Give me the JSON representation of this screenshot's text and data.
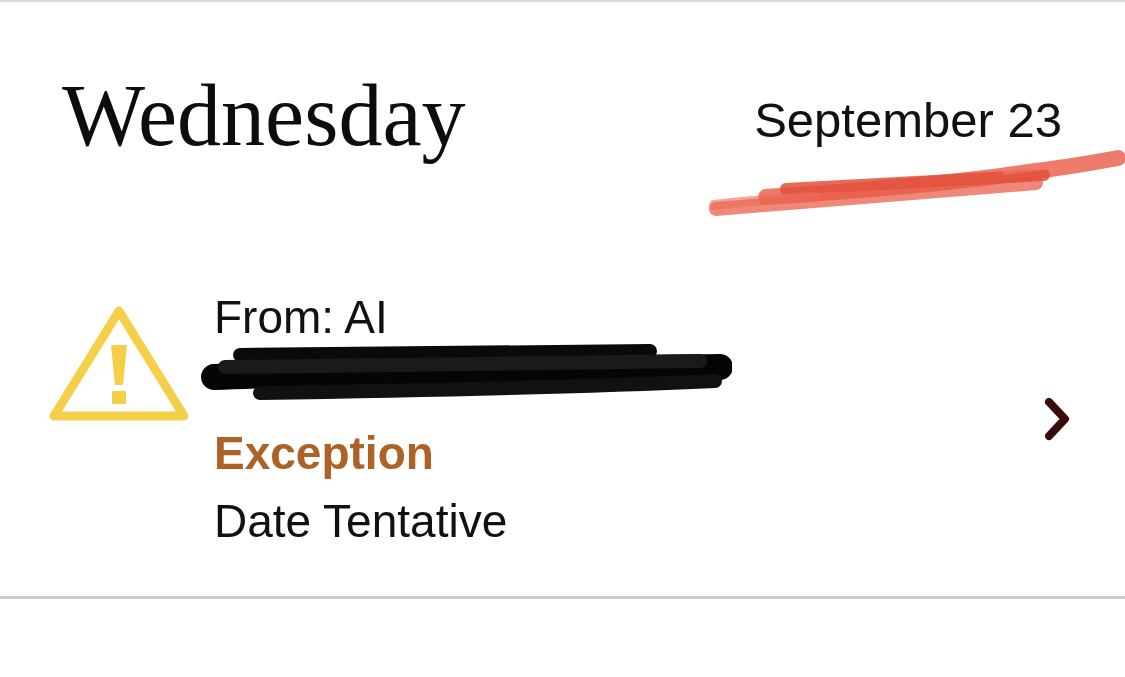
{
  "header": {
    "day": "Wednesday",
    "date": "September 23"
  },
  "shipments": [
    {
      "from": "From: AI",
      "status": {
        "kind": "exception",
        "label": "Exception"
      },
      "detail": "Date Tentative"
    }
  ]
}
